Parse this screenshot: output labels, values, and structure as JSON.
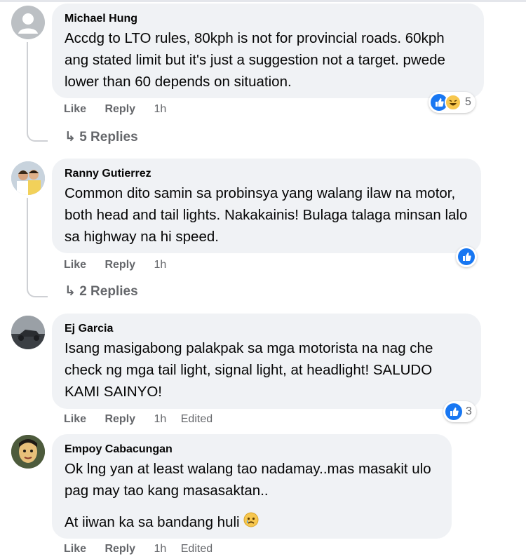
{
  "comments": [
    {
      "author": "Michael Hung",
      "lines": [
        "Accdg to LTO rules, 80kph is not for provincial roads. 60kph ang stated limit but it's just a suggestion not a target. pwede lower than 60 depends on situation."
      ],
      "actions": {
        "like": "Like",
        "reply": "Reply",
        "time": "1h"
      },
      "reactions": {
        "icons": [
          "like-icon",
          "haha-icon"
        ],
        "count": "5"
      },
      "replies": "5 Replies"
    },
    {
      "author": "Ranny Gutierrez",
      "lines": [
        "Common dito samin sa probinsya yang walang ilaw na motor, both head and tail lights. Nakakainis! Bulaga talaga minsan lalo sa highway na hi speed."
      ],
      "actions": {
        "like": "Like",
        "reply": "Reply",
        "time": "1h"
      },
      "reactions": {
        "icons": [
          "like-icon"
        ],
        "count": ""
      },
      "replies": "2 Replies"
    },
    {
      "author": "Ej Garcia",
      "lines": [
        "Isang masigabong palakpak sa mga motorista na nag che check ng mga tail light, signal light, at headlight! SALUDO KAMI SAINYO!"
      ],
      "actions": {
        "like": "Like",
        "reply": "Reply",
        "time": "1h",
        "edited": "Edited"
      },
      "reactions": {
        "icons": [
          "like-icon"
        ],
        "count": "3"
      }
    },
    {
      "author": "Empoy Cabacungan",
      "lines": [
        "Ok lng yan at least walang tao nadamay..mas masakit ulo pag may tao kang masasaktan..",
        "At iiwan ka sa bandang huli"
      ],
      "emoji": "crying-face-icon",
      "actions": {
        "like": "Like",
        "reply": "Reply",
        "time": "1h",
        "edited": "Edited"
      }
    }
  ],
  "colors": {
    "like_blue": "#1877f2",
    "bubble": "#f0f2f5",
    "meta_gray": "#65676b"
  }
}
